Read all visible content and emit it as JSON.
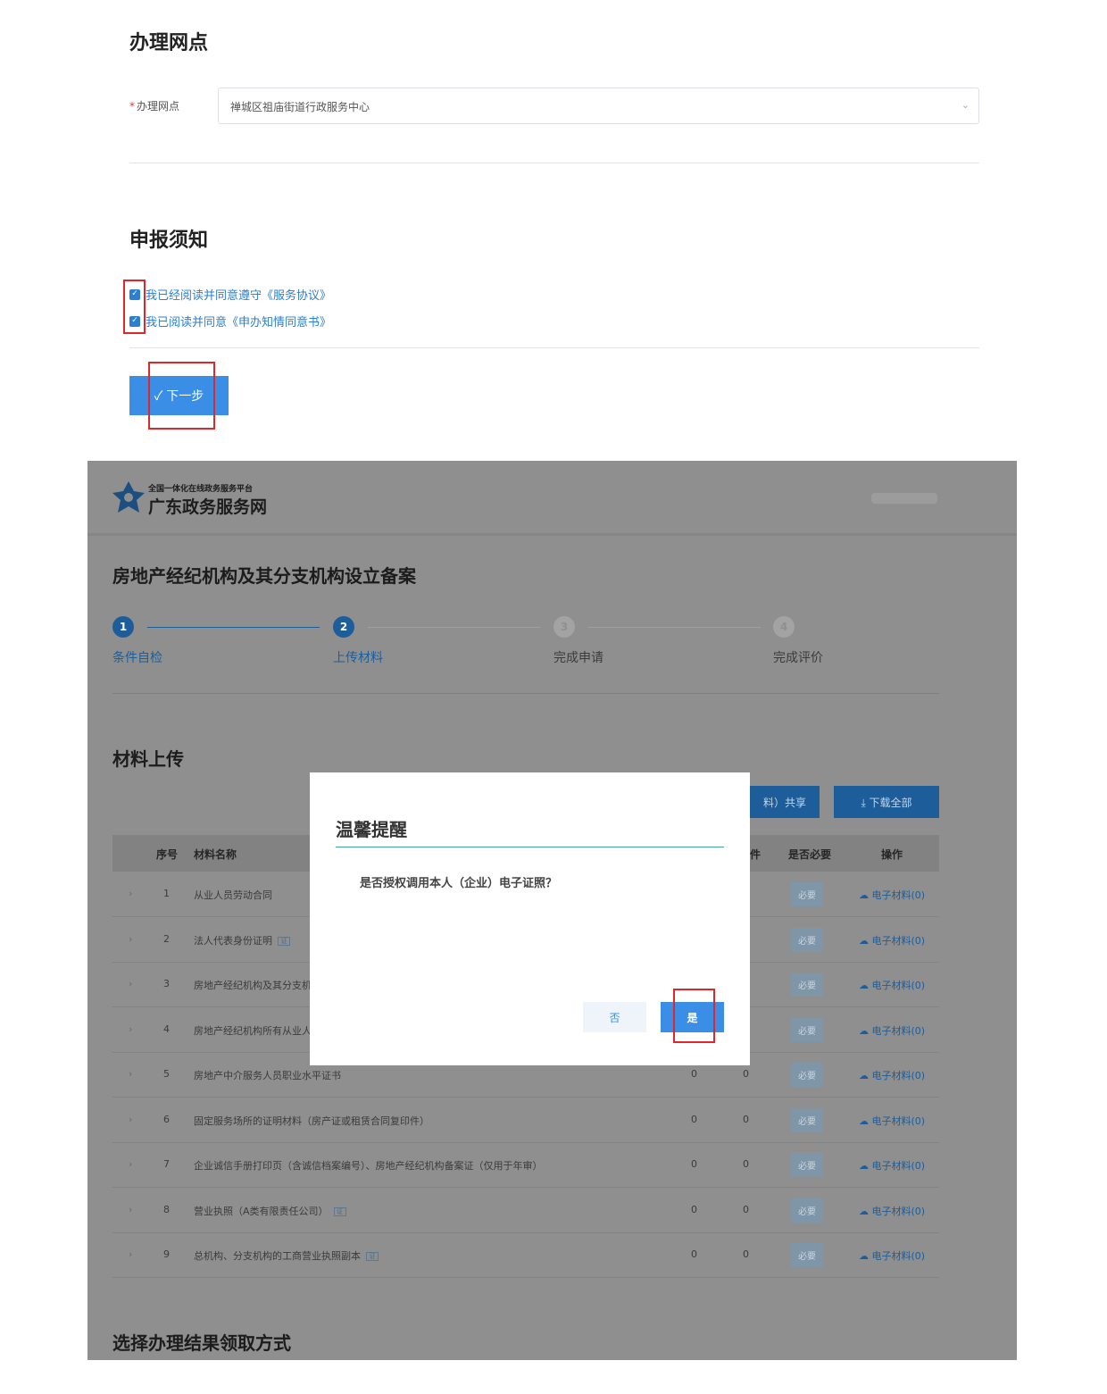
{
  "site_office": {
    "title": "办理网点",
    "required_mark": "*",
    "field_label": "办理网点",
    "selected_value": "禅城区祖庙街道行政服务中心"
  },
  "notice": {
    "title": "申报须知",
    "agreements": [
      {
        "label": "我已经阅读并同意遵守《服务协议》",
        "checked": true
      },
      {
        "label": "我已阅读并同意《申办知情同意书》",
        "checked": true
      }
    ],
    "next_button": "✓ 下一步"
  },
  "app": {
    "logo_subtitle": "全国一体化在线政务服务平台",
    "logo_title": "广东政务服务网",
    "page_title": "房地产经纪机构及其分支机构设立备案",
    "steps": [
      {
        "number": "1",
        "label": "条件自检",
        "state": "done"
      },
      {
        "number": "2",
        "label": "上传材料",
        "state": "active"
      },
      {
        "number": "3",
        "label": "完成申请",
        "state": "pending"
      },
      {
        "number": "4",
        "label": "完成评价",
        "state": "pending"
      }
    ],
    "materials": {
      "title": "材料上传",
      "share_button": "料）共享",
      "download_all_button": "⤓ 下载全部",
      "headers": {
        "index": "序号",
        "name": "材料名称",
        "partial": "件",
        "required": "是否必要",
        "action": "操作"
      },
      "rows": [
        {
          "index": "1",
          "name": "从业人员劳动合同",
          "c1": "",
          "c2": "",
          "e_badge": false,
          "required": "必要",
          "action": "电子材料(0)"
        },
        {
          "index": "2",
          "name": "法人代表身份证明",
          "c1": "",
          "c2": "",
          "e_badge": true,
          "required": "必要",
          "action": "电子材料(0)"
        },
        {
          "index": "3",
          "name": "房地产经纪机构及其分支机",
          "c1": "",
          "c2": "",
          "e_badge": false,
          "required": "必要",
          "action": "电子材料(0)"
        },
        {
          "index": "4",
          "name": "房地产经纪机构所有从业人",
          "c1": "",
          "c2": "",
          "e_badge": false,
          "required": "必要",
          "action": "电子材料(0)"
        },
        {
          "index": "5",
          "name": "房地产中介服务人员职业水平证书",
          "c1": "0",
          "c2": "0",
          "e_badge": false,
          "required": "必要",
          "action": "电子材料(0)"
        },
        {
          "index": "6",
          "name": "固定服务场所的证明材料（房产证或租赁合同复印件）",
          "c1": "0",
          "c2": "0",
          "e_badge": false,
          "required": "必要",
          "action": "电子材料(0)"
        },
        {
          "index": "7",
          "name": "企业诚信手册打印页（含诚信档案编号）、房地产经纪机构备案证（仅用于年审）",
          "c1": "0",
          "c2": "0",
          "e_badge": false,
          "required": "必要",
          "action": "电子材料(0)"
        },
        {
          "index": "8",
          "name": "营业执照（A类有限责任公司）",
          "c1": "0",
          "c2": "0",
          "e_badge": true,
          "required": "必要",
          "action": "电子材料(0)"
        },
        {
          "index": "9",
          "name": "总机构、分支机构的工商营业执照副本",
          "c1": "0",
          "c2": "0",
          "e_badge": true,
          "required": "必要",
          "action": "电子材料(0)"
        }
      ]
    },
    "result_section_title": "选择办理结果领取方式"
  },
  "modal": {
    "title": "温馨提醒",
    "message": "是否授权调用本人（企业）电子证照？",
    "no_button": "否",
    "yes_button": "是"
  },
  "colors": {
    "primary": "#3a8ee6",
    "highlight": "#e0252b",
    "overlay": "#8f8f8f"
  }
}
